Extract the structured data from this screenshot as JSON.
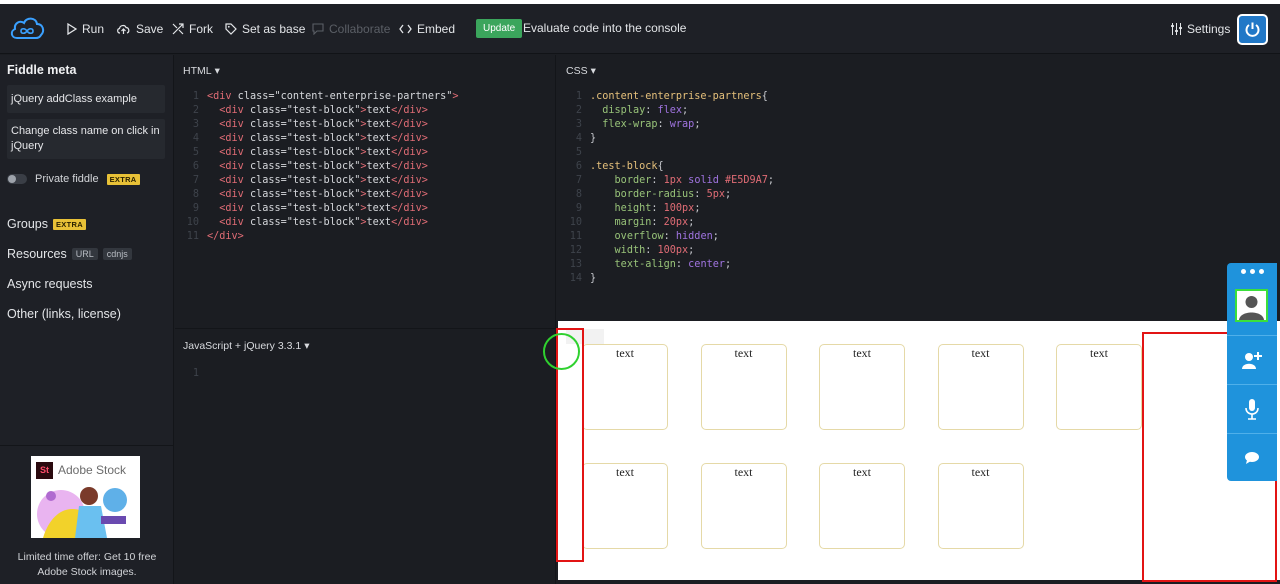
{
  "toolbar": {
    "run": "Run",
    "save": "Save",
    "fork": "Fork",
    "set_as_base": "Set as base",
    "collaborate": "Collaborate",
    "embed": "Embed",
    "update": "Update",
    "evaluate": "Evaluate code into the console",
    "settings": "Settings"
  },
  "sidebar": {
    "title": "Fiddle meta",
    "fiddle_title": "jQuery addClass example",
    "fiddle_description": "Change class name on click in jQuery",
    "private_label": "Private fiddle",
    "extra": "EXTRA",
    "groups": "Groups",
    "resources": "Resources",
    "resources_tags": [
      "URL",
      "cdnjs"
    ],
    "async": "Async requests",
    "other": "Other (links, license)"
  },
  "ad": {
    "brand": "Adobe Stock",
    "logo": "St",
    "line1": "Limited time offer: Get 10 free",
    "line2": "Adobe Stock images."
  },
  "panels": {
    "html_label": "HTML",
    "css_label": "CSS",
    "js_label": "JavaScript + jQuery 3.3.1"
  },
  "html_code": [
    "<div class=\"content-enterprise-partners\">",
    "  <div class=\"test-block\">text</div>",
    "  <div class=\"test-block\">text</div>",
    "  <div class=\"test-block\">text</div>",
    "  <div class=\"test-block\">text</div>",
    "  <div class=\"test-block\">text</div>",
    "  <div class=\"test-block\">text</div>",
    "  <div class=\"test-block\">text</div>",
    "  <div class=\"test-block\">text</div>",
    "  <div class=\"test-block\">text</div>",
    "</div>"
  ],
  "css_code": [
    ".content-enterprise-partners{",
    "  display: flex;",
    "  flex-wrap: wrap;",
    "}",
    "",
    ".test-block{",
    "    border: 1px solid #E5D9A7;",
    "    border-radius: 5px;",
    "    height: 100px;",
    "    margin: 20px;",
    "    overflow: hidden;",
    "    width: 100px;",
    "    text-align: center;",
    "}"
  ],
  "js_code": [
    ""
  ],
  "result": {
    "block_text": "text",
    "block_count": 9
  },
  "colors": {
    "accent": "#2178c7",
    "update": "#3ba55c",
    "extra": "#e8c137",
    "block_border": "#E5D9A7",
    "annotation_red": "#e21414",
    "annotation_green": "#2fd12f",
    "widget_blue": "#1f93dc"
  },
  "icons": {
    "logo": "jsfiddle-cloud-logo",
    "run": "play-icon",
    "save": "cloud-upload-icon",
    "fork": "fork-icon",
    "set_as_base": "tag-icon",
    "collaborate": "chat-icon",
    "embed": "code-icon",
    "settings": "sliders-icon",
    "power": "power-icon"
  }
}
